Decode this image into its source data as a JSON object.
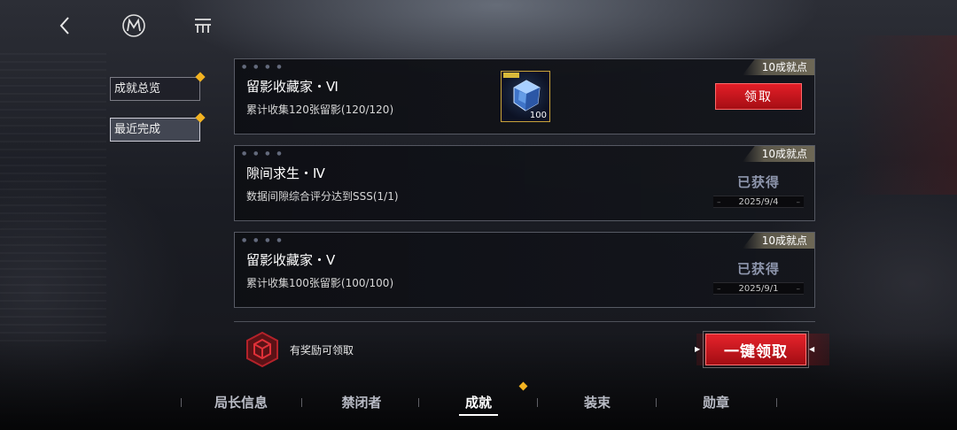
{
  "side_menu": [
    {
      "label": "成就总览",
      "active": false,
      "has_notice": true
    },
    {
      "label": "最近完成",
      "active": true,
      "has_notice": true
    }
  ],
  "achievements": [
    {
      "title": "留影收藏家・Ⅵ",
      "description": "累计收集120张留影(120/120)",
      "points": "10成就点",
      "reward": {
        "icon": "crystal-cube-icon",
        "quantity": "100"
      },
      "action": "领取"
    },
    {
      "title": "隙间求生・Ⅳ",
      "description": "数据间隙综合评分达到SSS(1/1)",
      "points": "10成就点",
      "status": "已获得",
      "date": "2025/9/4"
    },
    {
      "title": "留影收藏家・Ⅴ",
      "description": "累计收集100张留影(100/100)",
      "points": "10成就点",
      "status": "已获得",
      "date": "2025/9/1"
    }
  ],
  "claim_bar": {
    "label": "有奖励可领取",
    "button": "一键领取"
  },
  "tabs": [
    {
      "label": "局长信息",
      "active": false
    },
    {
      "label": "禁闭者",
      "active": false
    },
    {
      "label": "成就",
      "active": true
    },
    {
      "label": "装束",
      "active": false
    },
    {
      "label": "勋章",
      "active": false
    }
  ],
  "colors": {
    "accent_red": "#e31e27",
    "notice_gold": "#f3b321",
    "obtained_text": "#8e96ad"
  }
}
